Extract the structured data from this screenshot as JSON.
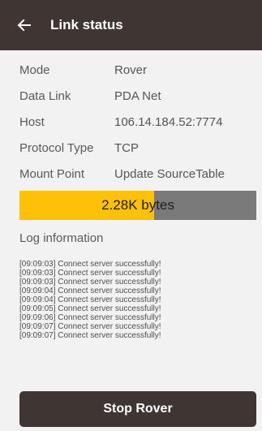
{
  "appbar": {
    "title": "Link status",
    "back_icon": "arrow-left-icon"
  },
  "details": [
    {
      "label": "Mode",
      "value": "Rover"
    },
    {
      "label": "Data Link",
      "value": "PDA Net"
    },
    {
      "label": "Host",
      "value": "106.14.184.52:7774"
    },
    {
      "label": "Protocol Type",
      "value": "TCP"
    },
    {
      "label": "Mount Point",
      "value": "Update SourceTable"
    }
  ],
  "progress": {
    "text": "2.28K bytes",
    "fill_fraction": 0.57,
    "fill_color": "#ffc107",
    "track_color": "#7a7a7a"
  },
  "log": {
    "title": "Log information",
    "lines": [
      "[09:09:03] Connect server successfully!",
      "[09:09:03] Connect server successfully!",
      "[09:09:03] Connect server successfully!",
      "[09:09:04] Connect server successfully!",
      "[09:09:04] Connect server successfully!",
      "[09:09:05] Connect server successfully!",
      "[09:09:06] Connect server successfully!",
      "[09:09:07] Connect server successfully!",
      "[09:09:07] Connect server successfully!"
    ]
  },
  "actions": {
    "stop_label": "Stop Rover"
  },
  "colors": {
    "appbar": "#3f3634",
    "background": "#f2f2f2"
  }
}
